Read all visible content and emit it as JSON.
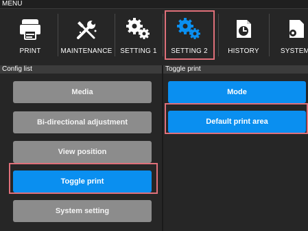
{
  "menu": {
    "title": "MENU",
    "items": [
      {
        "label": "PRINT",
        "icon": "print-icon"
      },
      {
        "label": "MAINTENANCE",
        "icon": "tools-icon"
      },
      {
        "label": "SETTING 1",
        "icon": "gears-icon"
      },
      {
        "label": "SETTING 2",
        "icon": "gears-blue-icon"
      },
      {
        "label": "HISTORY",
        "icon": "history-icon"
      },
      {
        "label": "SYSTEM",
        "icon": "system-icon"
      }
    ],
    "selected": "SETTING 2"
  },
  "config_list": {
    "header": "Config list",
    "items": [
      {
        "label": "Media",
        "state": "normal"
      },
      {
        "label": "Bi-directional adjustment",
        "state": "normal"
      },
      {
        "label": "View position",
        "state": "normal"
      },
      {
        "label": "Toggle print",
        "state": "selected"
      },
      {
        "label": "System setting",
        "state": "normal"
      }
    ]
  },
  "toggle_print": {
    "header": "Toggle print",
    "items": [
      {
        "label": "Mode",
        "state": "selected"
      },
      {
        "label": "Default print area",
        "state": "selected"
      }
    ]
  },
  "colors": {
    "accent_blue": "#0a8ff0",
    "button_gray": "#8c8c8c",
    "highlight": "#e0707a",
    "background": "#262626"
  }
}
